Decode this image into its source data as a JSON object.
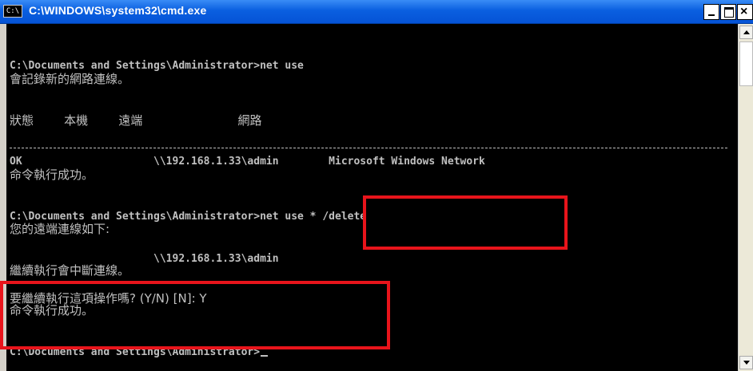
{
  "window": {
    "title": "C:\\WINDOWS\\system32\\cmd.exe",
    "icon_text": "C:\\"
  },
  "console": {
    "lines": [
      "C:\\Documents and Settings\\Administrator>net use",
      "會記錄新的網路連線。",
      "狀態        本機        遠端                         網路",
      "OK                     \\\\192.168.1.33\\admin        Microsoft Windows Network",
      "命令執行成功。",
      "C:\\Documents and Settings\\Administrator>net use * /delete",
      "您的遠端連線如下:",
      "                       \\\\192.168.1.33\\admin",
      "繼續執行會中斷連線。",
      "要繼續執行這項操作嗎? (Y/N) [N]: Y",
      "命令執行成功。",
      "C:\\Documents and Settings\\Administrator>"
    ]
  },
  "colors": {
    "highlight": "#e8141b",
    "console_text": "#c0c0c0",
    "titlebar": "#0a5fe0"
  }
}
